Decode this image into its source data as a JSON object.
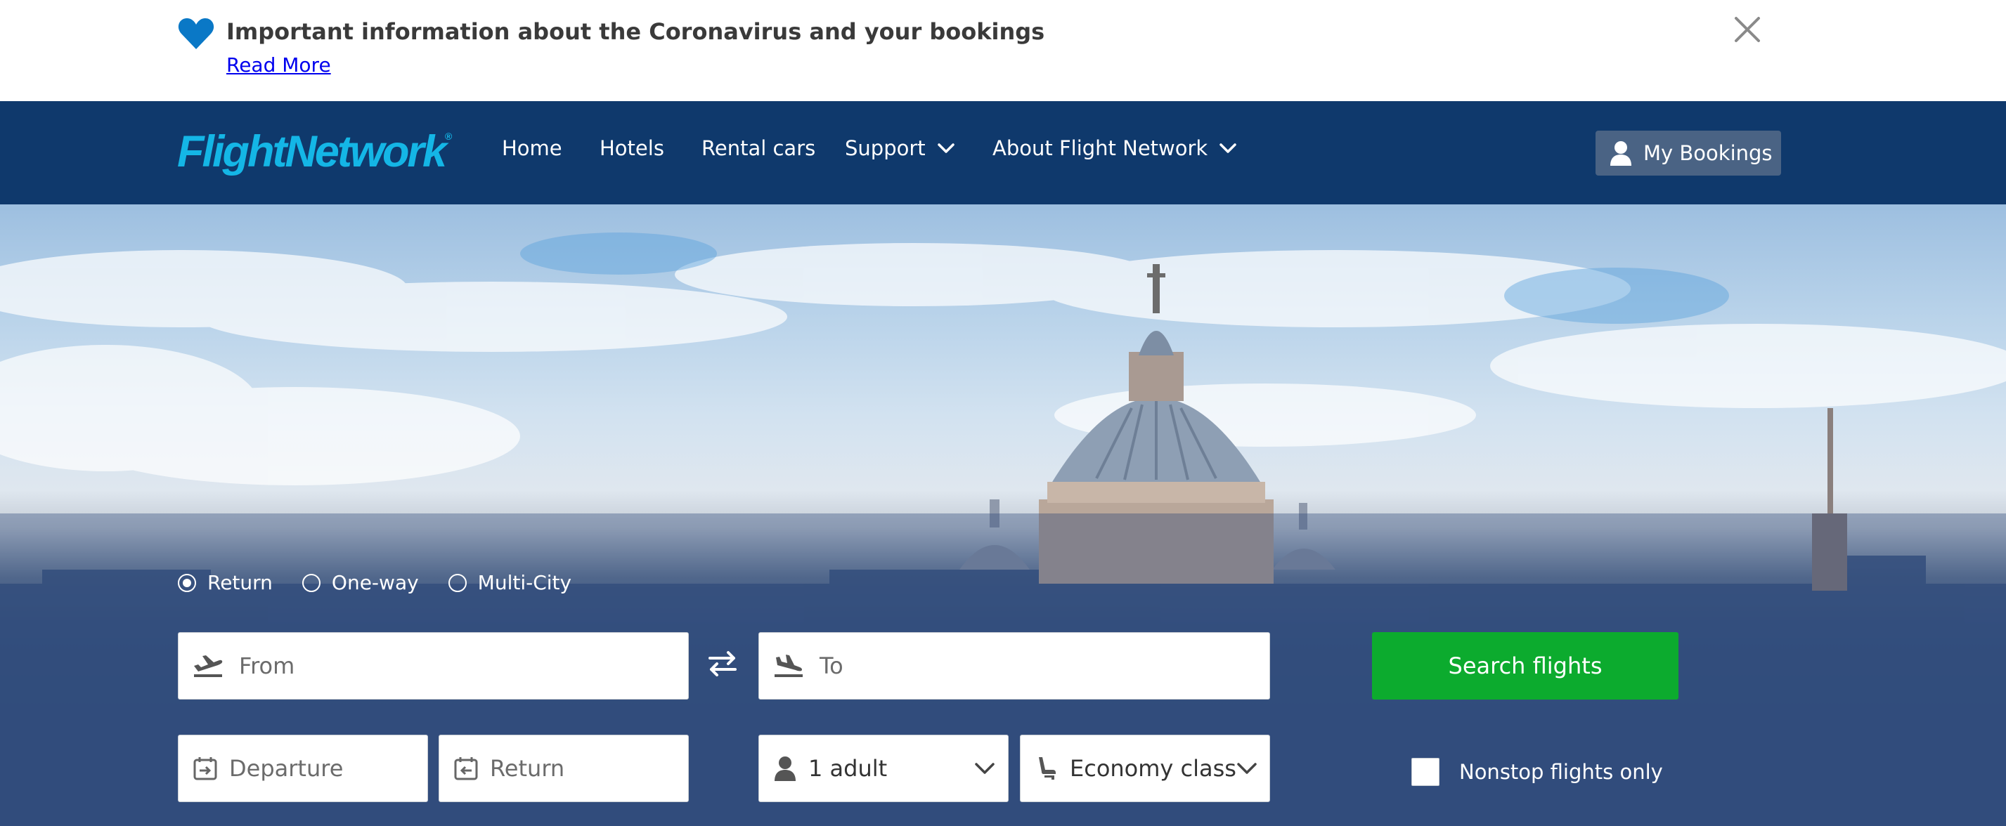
{
  "notice": {
    "title": "Important information about the Coronavirus and your bookings",
    "link": "Read More",
    "heart_color": "#0a78c6"
  },
  "header": {
    "logo": "FlightNetwork",
    "nav": [
      {
        "label": "Home",
        "has_dropdown": false
      },
      {
        "label": "Hotels",
        "has_dropdown": false
      },
      {
        "label": "Rental cars",
        "has_dropdown": false
      },
      {
        "label": "Support",
        "has_dropdown": true
      },
      {
        "label": "About Flight Network",
        "has_dropdown": true
      }
    ],
    "bookings_label": "My Bookings",
    "background": "#0f396c",
    "logo_color": "#14b6e6"
  },
  "search": {
    "trip_types": [
      {
        "label": "Return",
        "selected": true
      },
      {
        "label": "One-way",
        "selected": false
      },
      {
        "label": "Multi-City",
        "selected": false
      }
    ],
    "from_placeholder": "From",
    "to_placeholder": "To",
    "departure_placeholder": "Departure",
    "return_placeholder": "Return",
    "passengers": "1 adult",
    "cabin_class": "Economy class",
    "search_label": "Search flights",
    "nonstop_label": "Nonstop flights only",
    "nonstop_checked": false,
    "button_color": "#0cab2e"
  }
}
